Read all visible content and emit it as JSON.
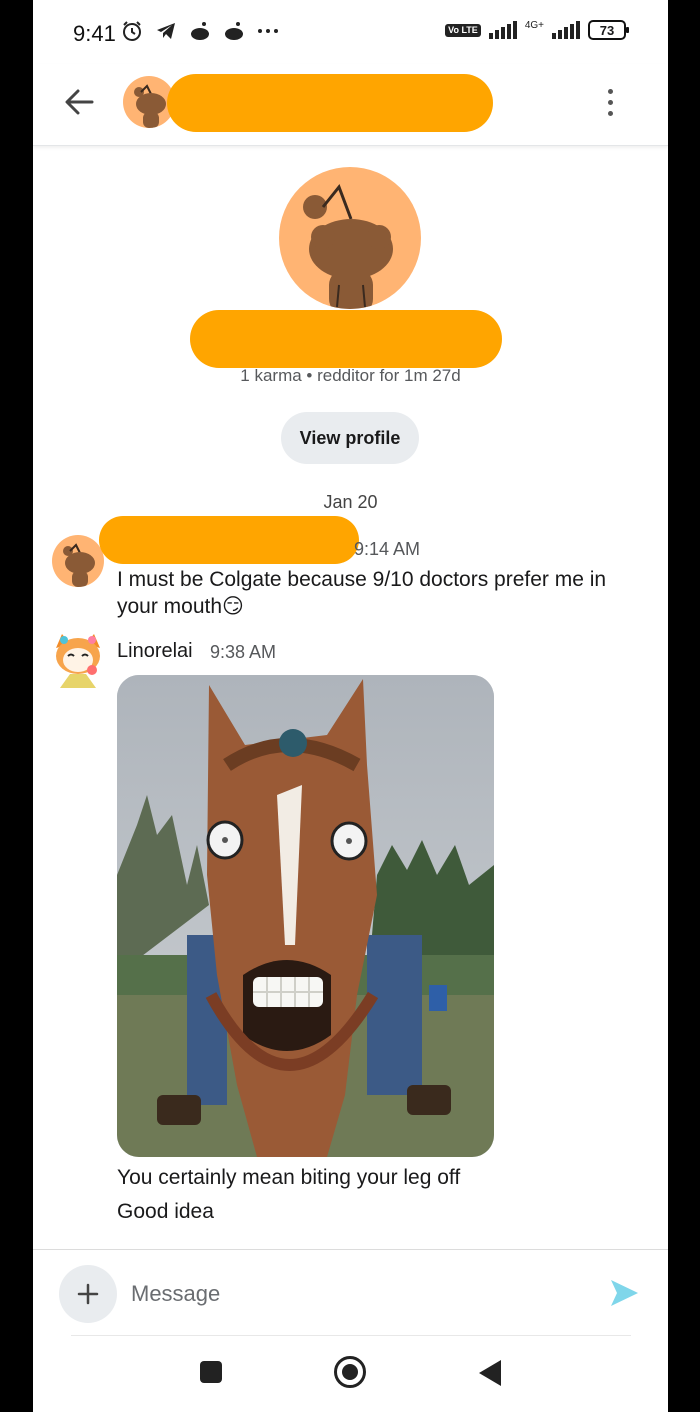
{
  "status_bar": {
    "time": "9:41",
    "network_badge": "Vo LTE",
    "network_type": "4G+",
    "battery": "73"
  },
  "profile": {
    "meta": "1 karma • redditor for 1m 27d",
    "view_profile_label": "View profile"
  },
  "conversation": {
    "date": "Jan 20",
    "messages": [
      {
        "author": "",
        "time": "9:14 AM",
        "text": "I must be Colgate because 9/10 doctors prefer me in your mouth😏"
      },
      {
        "author": "Linorelai",
        "time": "9:38 AM",
        "lines": [
          "You certainly mean biting your leg off",
          "Good idea"
        ]
      }
    ]
  },
  "composer": {
    "placeholder": "Message"
  },
  "colors": {
    "redaction": "#ffa500",
    "avatar_bg": "#ffb473",
    "send": "#7fd6ea"
  }
}
